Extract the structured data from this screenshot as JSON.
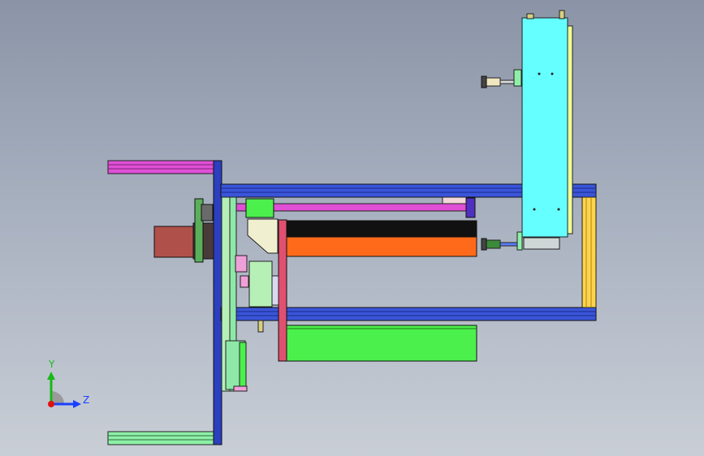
{
  "viewport": {
    "colors": {
      "frame_blue": "#2b3fbf",
      "rail_blue": "#3a55d8",
      "magenta": "#e04fd6",
      "light_green": "#8ef0a8",
      "bright_green": "#4cf04c",
      "orange": "#ff6a1a",
      "cyan": "#66ffff",
      "yellow": "#ffd44a",
      "motor_red": "#b0504a",
      "dark": "#2a2a2a"
    }
  },
  "triad": {
    "y_label": "Y",
    "z_label": "Z",
    "x_axis_color": "#e01010",
    "y_axis_color": "#18b818",
    "z_axis_color": "#1a40ff"
  }
}
